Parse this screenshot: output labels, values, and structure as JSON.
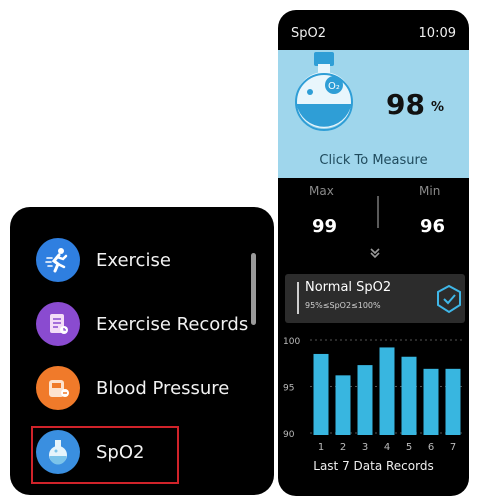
{
  "menu": {
    "items": [
      {
        "label": "Exercise",
        "icon": "running-person-icon",
        "color": "#2f7fe0"
      },
      {
        "label": "Exercise Records",
        "icon": "records-icon",
        "color": "#8a4bd0"
      },
      {
        "label": "Blood Pressure",
        "icon": "blood-pressure-icon",
        "color": "#f07a2a"
      },
      {
        "label": "SpO2",
        "icon": "spo2-flask-icon",
        "color": "#3a8fe0"
      }
    ],
    "selected": "SpO2"
  },
  "detail": {
    "title": "SpO2",
    "time": "10:09",
    "measure": {
      "flask_label": "O₂",
      "value": "98",
      "unit": "%",
      "action": "Click To Measure"
    },
    "max": {
      "label": "Max",
      "value": "99"
    },
    "min": {
      "label": "Min",
      "value": "96"
    },
    "status": {
      "title": "Normal SpO2",
      "range": "95%≤SpO2≤100%"
    }
  },
  "chart_data": {
    "type": "bar",
    "categories": [
      "1",
      "2",
      "3",
      "4",
      "5",
      "6",
      "7"
    ],
    "values": [
      98.5,
      96.2,
      97.3,
      99.2,
      98.2,
      96.9,
      96.9
    ],
    "ylim": [
      90,
      100
    ],
    "yticks": [
      "100",
      "95",
      "90"
    ],
    "title": "Last 7 Data Records",
    "bar_color": "#38b6e0",
    "grid": true
  }
}
